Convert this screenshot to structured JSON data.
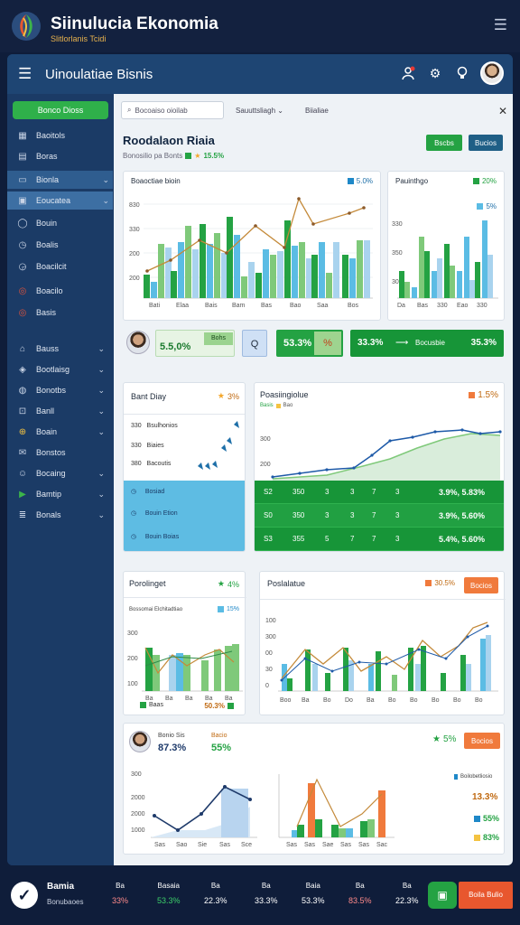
{
  "header": {
    "title": "Siinulucia Ekonomia",
    "subtitle": "Slitlorlanis Tcidi"
  },
  "topbar": {
    "title": "Uinoulatiae Bisnis",
    "icons": [
      "user-icon",
      "gear-icon",
      "bulb-icon"
    ]
  },
  "sidebar": {
    "items": [
      {
        "label": "Bonco Dioss",
        "icon": "plus-icon",
        "chev": false
      },
      {
        "label": "Baoitols",
        "icon": "chart-icon",
        "chev": false
      },
      {
        "label": "Boras",
        "icon": "doc-icon",
        "chev": false
      },
      {
        "label": "Bionla",
        "icon": "folder-icon",
        "chev": true
      },
      {
        "label": "Eoucatea",
        "icon": "box-icon",
        "chev": true
      },
      {
        "label": "Bouin",
        "icon": "circle-icon",
        "chev": false
      },
      {
        "label": "Boalis",
        "icon": "clock-icon",
        "chev": false
      },
      {
        "label": "Boacilcit",
        "icon": "clock-icon",
        "chev": false
      },
      {
        "label": "Boacilo",
        "icon": "target-icon",
        "chev": false
      },
      {
        "label": "Basis",
        "icon": "target-icon",
        "chev": false
      },
      {
        "label": "Bauss",
        "icon": "home-icon",
        "chev": true
      },
      {
        "label": "Bootlaisg",
        "icon": "tag-icon",
        "chev": true
      },
      {
        "label": "Bonotbs",
        "icon": "globe-icon",
        "chev": true
      },
      {
        "label": "Banll",
        "icon": "pin-icon",
        "chev": true
      },
      {
        "label": "Boain",
        "icon": "cart-icon",
        "chev": true
      },
      {
        "label": "Bonstos",
        "icon": "mail-icon",
        "chev": false
      },
      {
        "label": "Bocaing",
        "icon": "person-icon",
        "chev": true
      },
      {
        "label": "Bamtip",
        "icon": "play-icon",
        "chev": true
      },
      {
        "label": "Bonals",
        "icon": "list-icon",
        "chev": true
      }
    ]
  },
  "main": {
    "search_placeholder": "Bocoaiso oioilab",
    "filter": "Sauuttsliagh",
    "filter2": "Biialiae",
    "page_title": "Roodalaon Riaia",
    "page_sub": "Bonosilio pa Bonts",
    "page_pct": "15.5%",
    "btn_a": "Bscbs",
    "btn_b": "Bucios"
  },
  "card1": {
    "title": "Boaoctiae bioin",
    "badge": "5.0%",
    "ylabels": [
      "830",
      "330",
      "200",
      "200"
    ],
    "xlabels": [
      "Bati",
      "Elaa",
      "Bais",
      "Bam",
      "Bas",
      "Bao",
      "Saa",
      "Bos"
    ]
  },
  "card2": {
    "title": "Pauinthgo",
    "badge": "20%",
    "badge2": "5%",
    "ylabels": [
      "330",
      "350",
      "300"
    ],
    "xlabels": [
      "Da",
      "Bas",
      "330",
      "Eao",
      "330"
    ]
  },
  "kpi": {
    "v1": "5.5,0%",
    "tag": "Bohs",
    "q": "Q",
    "v2": "53.3%",
    "v3": "33.3%",
    "mid": "Bocusbie",
    "v4": "35.3%"
  },
  "card3": {
    "title": "Bant Diay",
    "badge": "3%",
    "rows": [
      {
        "v": "330",
        "l": "Bsulhonios"
      },
      {
        "v": "330",
        "l": "Biaies"
      },
      {
        "v": "380",
        "l": "Bacoutis"
      }
    ],
    "list": [
      "Bosiad",
      "Bouin Etion",
      "Bouin Boias"
    ]
  },
  "card4": {
    "title": "Poasiingiolue",
    "badge": "1.5%",
    "leg1": "Basis",
    "leg2": "Bao",
    "ylabels": [
      "300",
      "200"
    ],
    "rows": [
      [
        "S2",
        "350",
        "3",
        "3",
        "7",
        "3",
        "3.9%, 5.83%"
      ],
      [
        "S0",
        "350",
        "3",
        "3",
        "7",
        "3",
        "3.9%, 5.60%"
      ],
      [
        "S3",
        "355",
        "5",
        "7",
        "7",
        "3",
        "5.4%, 5.60%"
      ]
    ]
  },
  "card5": {
    "title": "Porolinget",
    "badge": "4%",
    "sub": "Bossomai Elchitadtiao",
    "sub_badge": "15%",
    "foot": "Baas",
    "foot_v": "50.3%",
    "ylabels": [
      "300",
      "200",
      "100"
    ],
    "xlabels": [
      "Ba",
      "Ba",
      "Ba",
      "Ba",
      "Ba"
    ]
  },
  "card6": {
    "title": "Poslalatue",
    "badge": "30.5%",
    "btn": "Bocios",
    "ylabels": [
      "100",
      "300",
      "00",
      "30",
      "0"
    ],
    "xlabels": [
      "Boo",
      "Ba",
      "Bo",
      "Do",
      "Ba",
      "Bo",
      "Bo",
      "Bo",
      "Bo",
      "Bo"
    ]
  },
  "card7": {
    "label1": "Bonio Sis",
    "v1": "87.3%",
    "label2": "Bacio",
    "v2": "55%",
    "badge": "5%",
    "btn": "Bocios",
    "ylabels": [
      "300",
      "2000",
      "2000",
      "1000"
    ],
    "xlabels": [
      "Sas",
      "Sao",
      "Sie",
      "Sas",
      "Sce"
    ],
    "legend": "Boilobetliosio",
    "p1": "13.3%",
    "p2": "55%",
    "p3": "83%"
  },
  "bottombar": {
    "title": "Bamia",
    "sub": "Bonubaoes",
    "cols": [
      {
        "l": "Ba",
        "v": "33%"
      },
      {
        "l": "Basaia",
        "v": "53.3%"
      },
      {
        "l": "Ba",
        "v": "22.3%"
      },
      {
        "l": "Ba",
        "v": "33.3%"
      },
      {
        "l": "Baia",
        "v": "53.3%"
      },
      {
        "l": "Ba",
        "v": "83.5%"
      },
      {
        "l": "Ba",
        "v": "22.3%"
      }
    ],
    "cta": "Boila Bulio"
  }
}
